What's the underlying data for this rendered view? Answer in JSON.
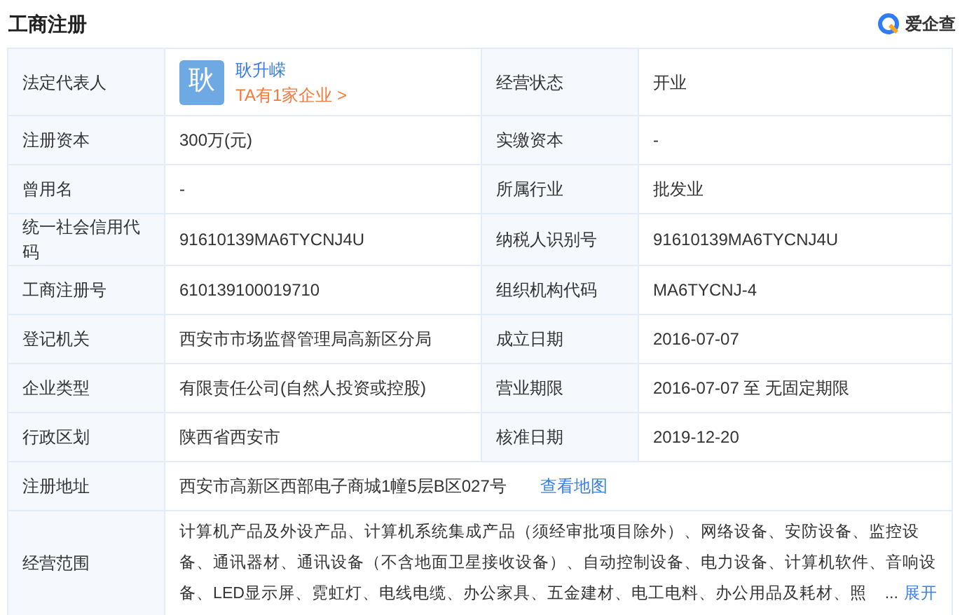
{
  "header": {
    "title": "工商注册",
    "brand": "爱企查"
  },
  "rows": [
    {
      "fields": [
        {
          "kind": "person",
          "label": "法定代表人",
          "avatar": "耿",
          "name": "耿升嵘",
          "link": "TA有1家企业 >"
        },
        {
          "kind": "text",
          "label": "经营状态",
          "value": "开业"
        }
      ]
    },
    {
      "fields": [
        {
          "kind": "text",
          "label": "注册资本",
          "value": "300万(元)"
        },
        {
          "kind": "text",
          "label": "实缴资本",
          "value": "-"
        }
      ]
    },
    {
      "fields": [
        {
          "kind": "text",
          "label": "曾用名",
          "value": "-"
        },
        {
          "kind": "text",
          "label": "所属行业",
          "value": "批发业"
        }
      ]
    },
    {
      "fields": [
        {
          "kind": "text",
          "label": "统一社会信用代码",
          "value": "91610139MA6TYCNJ4U"
        },
        {
          "kind": "text",
          "label": "纳税人识别号",
          "value": "91610139MA6TYCNJ4U"
        }
      ]
    },
    {
      "fields": [
        {
          "kind": "text",
          "label": "工商注册号",
          "value": "610139100019710"
        },
        {
          "kind": "text",
          "label": "组织机构代码",
          "value": "MA6TYCNJ-4"
        }
      ]
    },
    {
      "fields": [
        {
          "kind": "text",
          "label": "登记机关",
          "value": "西安市市场监督管理局高新区分局"
        },
        {
          "kind": "text",
          "label": "成立日期",
          "value": "2016-07-07"
        }
      ]
    },
    {
      "fields": [
        {
          "kind": "text",
          "label": "企业类型",
          "value": "有限责任公司(自然人投资或控股)"
        },
        {
          "kind": "text",
          "label": "营业期限",
          "value": "2016-07-07 至 无固定期限"
        }
      ]
    },
    {
      "fields": [
        {
          "kind": "text",
          "label": "行政区划",
          "value": "陕西省西安市"
        },
        {
          "kind": "text",
          "label": "核准日期",
          "value": "2019-12-20"
        }
      ]
    },
    {
      "fields": [
        {
          "kind": "address",
          "label": "注册地址",
          "value": "西安市高新区西部电子商城1幢5层B区027号",
          "link": "查看地图"
        }
      ]
    },
    {
      "fields": [
        {
          "kind": "scope",
          "label": "经营范围",
          "lines": [
            "计算机产品及外设产品、计算机系统集成产品（须经审批项目除外）、网络设备、安防设备、监控设",
            "备、通讯器材、通讯设备（不含地面卫星接收设备）、自动控制设备、电力设备、计算机软件、音响设",
            "备、LED显示屏、霓虹灯、电线电缆、办公家具、五金建材、电工电料、办公用品及耗材、照"
          ],
          "ellipsis": "...",
          "more": "展开"
        }
      ]
    }
  ]
}
